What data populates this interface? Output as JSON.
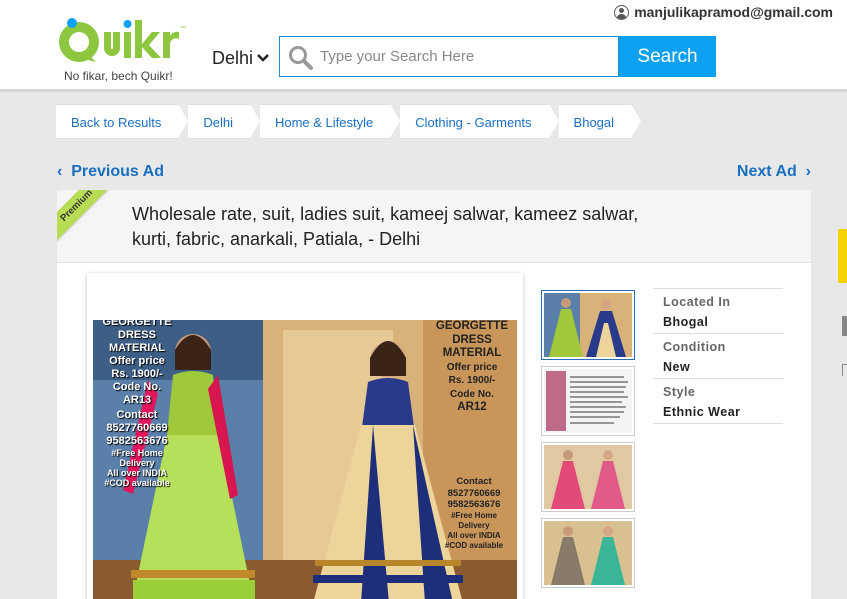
{
  "header": {
    "user_email": "manjulikapramod@gmail.com",
    "logo_text": "Quikr",
    "tagline": "No fikar, bech Quikr!",
    "city": "Delhi",
    "search_placeholder": "Type your Search Here",
    "search_button": "Search",
    "brand_color": "#8dc63f",
    "accent_color": "#0fa1f1"
  },
  "breadcrumb": [
    {
      "label": "Back to Results"
    },
    {
      "label": "Delhi"
    },
    {
      "label": "Home & Lifestyle"
    },
    {
      "label": "Clothing - Garments"
    },
    {
      "label": "Bhogal"
    }
  ],
  "ad_nav": {
    "prev": "Previous Ad",
    "next": "Next Ad"
  },
  "ad": {
    "badge": "Premium",
    "title": "Wholesale rate, suit, ladies suit, kameej salwar, kameez salwar, kurti, fabric, anarkali, Patiala, - Delhi"
  },
  "main_image": {
    "left_caption": [
      "GEORGETTE",
      "DRESS",
      "MATERIAL",
      "Offer price",
      "Rs. 1900/-",
      "Code No.",
      "AR13",
      "Contact",
      "8527760669",
      "9582563676",
      "#Free Home",
      "Delivery",
      "All over INDIA",
      "#COD available"
    ],
    "right_caption": [
      "GEORGETTE",
      "DRESS",
      "MATERIAL",
      "Offer price",
      "Rs. 1900/-",
      "Code No.",
      "AR12"
    ],
    "right_contact": [
      "Contact",
      "8527760669",
      "9582563676",
      "#Free Home",
      "Delivery",
      "All over INDIA",
      "#COD available"
    ]
  },
  "details": [
    {
      "label": "Located In",
      "value": "Bhogal"
    },
    {
      "label": "Condition",
      "value": "New"
    },
    {
      "label": "Style",
      "value": "Ethnic Wear"
    }
  ]
}
